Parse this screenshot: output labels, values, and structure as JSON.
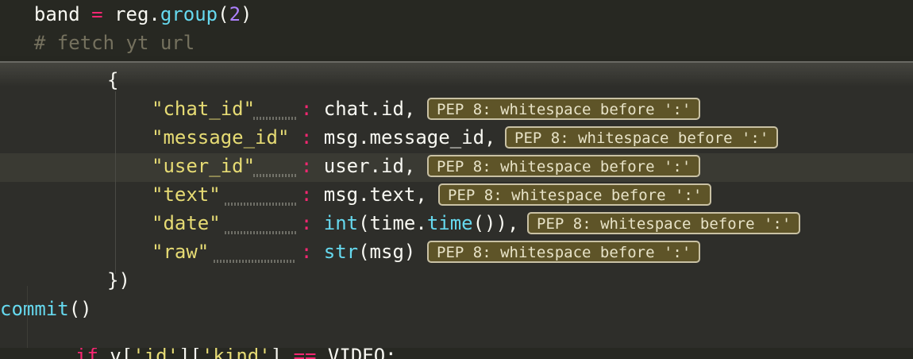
{
  "editor": {
    "line_band": {
      "indent": "  ",
      "var": "band",
      "op": "=",
      "obj": "reg.",
      "func": "group",
      "paren_open": "(",
      "num": "2",
      "paren_close": ")"
    },
    "line_comment": "  # fetch yt url",
    "panel": {
      "open_brace": "{",
      "close": "})",
      "rows": [
        {
          "key": "\"chat_id\"",
          "pad": "    ",
          "colon": ":",
          "value": " chat.id,",
          "hint": "PEP 8: whitespace before ':'"
        },
        {
          "key": "\"message_id\"",
          "pad": " ",
          "colon": ":",
          "value": " msg.message_id,",
          "hint": "PEP 8: whitespace before ':'"
        },
        {
          "key": "\"user_id\"",
          "pad": "    ",
          "colon": ":",
          "value": " user.id,",
          "hint": "PEP 8: whitespace before ':'"
        },
        {
          "key": "\"text\"",
          "pad": "       ",
          "colon": ":",
          "value": " msg.text,",
          "hint": "PEP 8: whitespace before ':'"
        },
        {
          "key": "\"date\"",
          "pad": "       ",
          "colon": ":",
          "value_func1": " int",
          "value_mid": "(time.",
          "value_func2": "time",
          "value_end": "()),",
          "hint": "PEP 8: whitespace before ':'"
        },
        {
          "key": "\"raw\"",
          "pad": "        ",
          "colon": ":",
          "value_func1": " str",
          "value_end": "(msg)",
          "hint": "PEP 8: whitespace before ':'"
        }
      ]
    },
    "line_commit": {
      "func": "commit",
      "parens": "()"
    },
    "line_if": {
      "kw": "if",
      "rest1": " v[",
      "s1": "'id'",
      "rest2": "][",
      "s2": "'kind'",
      "rest3": "] ",
      "op": "==",
      "rest4": " VIDEO:"
    }
  }
}
